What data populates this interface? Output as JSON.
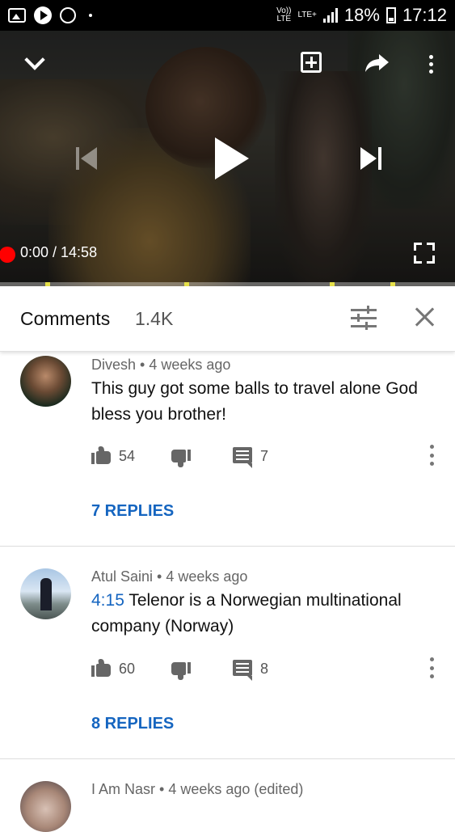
{
  "status_bar": {
    "volte": "Vo))",
    "lte": "LTE",
    "lte_plus": "LTE+",
    "battery": "18%",
    "time": "17:12"
  },
  "player": {
    "time_current": "0:00",
    "time_total": "14:58",
    "time_display": "0:00 / 14:58",
    "progress_fraction": 0.0,
    "state": "paused"
  },
  "comments_header": {
    "title": "Comments",
    "count": "1.4K"
  },
  "comments": [
    {
      "author": "Divesh",
      "age": "4 weeks ago",
      "meta": "Divesh • 4 weeks ago",
      "timestamp": "",
      "text": "This guy got some balls to travel alone  God bless you brother!",
      "likes": "54",
      "replies_count": "7",
      "replies_label": "7 REPLIES"
    },
    {
      "author": "Atul Saini",
      "age": "4 weeks ago",
      "meta": "Atul Saini • 4 weeks ago",
      "timestamp": "4:15",
      "text": " Telenor is a Norwegian multinational company (Norway)",
      "likes": "60",
      "replies_count": "8",
      "replies_label": "8 REPLIES"
    },
    {
      "author": "I Am Nasr",
      "age": "4 weeks ago (edited)",
      "meta": "I Am Nasr • 4 weeks ago (edited)"
    }
  ],
  "colors": {
    "accent_blue": "#1565c0",
    "progress_red": "#ff0000",
    "chapter_marker": "#e5e04a"
  }
}
